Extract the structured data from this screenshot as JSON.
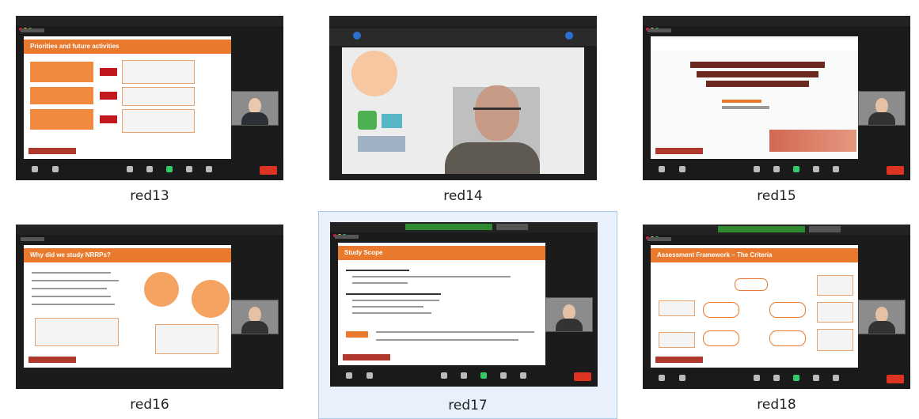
{
  "thumbnails": [
    {
      "label": "red13"
    },
    {
      "label": "red14"
    },
    {
      "label": "red15"
    },
    {
      "label": "red16"
    },
    {
      "label": "red17"
    },
    {
      "label": "red18"
    }
  ],
  "colors": {
    "selection_bg": "#e8f1fb",
    "selection_border": "#a9c8ea",
    "slide_orange": "#e9792c",
    "end_button": "#d32f2f"
  }
}
